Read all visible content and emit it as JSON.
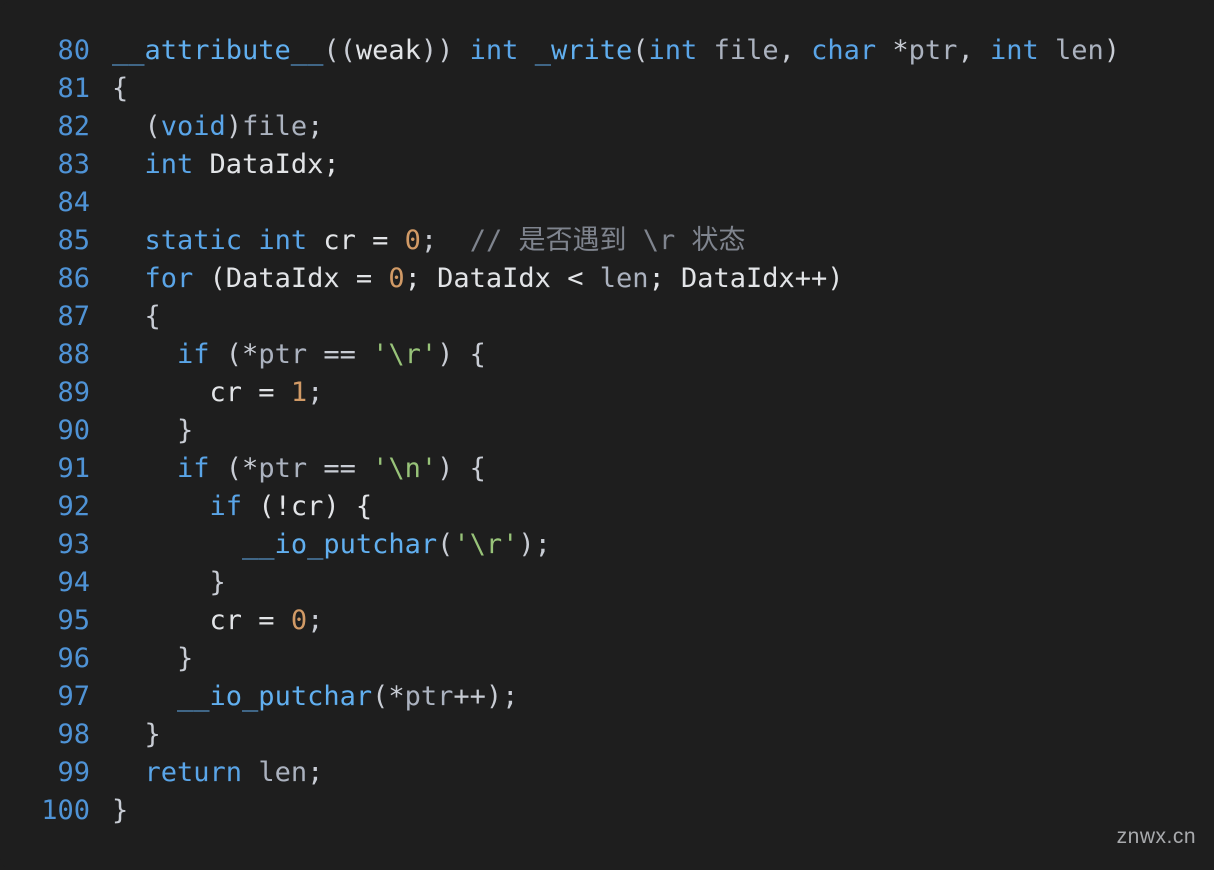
{
  "watermark": "znwx.cn",
  "lines": [
    {
      "num": "80",
      "tokens": [
        {
          "t": "__attribute__",
          "c": "call"
        },
        {
          "t": "((",
          "c": "punct"
        },
        {
          "t": "weak",
          "c": "id"
        },
        {
          "t": ")) ",
          "c": "punct"
        },
        {
          "t": "int",
          "c": "kw"
        },
        {
          "t": " ",
          "c": "punct"
        },
        {
          "t": "_write",
          "c": "call"
        },
        {
          "t": "(",
          "c": "punct"
        },
        {
          "t": "int",
          "c": "kw"
        },
        {
          "t": " ",
          "c": "punct"
        },
        {
          "t": "file",
          "c": "par"
        },
        {
          "t": ", ",
          "c": "punct"
        },
        {
          "t": "char",
          "c": "kw"
        },
        {
          "t": " *",
          "c": "punct"
        },
        {
          "t": "ptr",
          "c": "par"
        },
        {
          "t": ", ",
          "c": "punct"
        },
        {
          "t": "int",
          "c": "kw"
        },
        {
          "t": " ",
          "c": "punct"
        },
        {
          "t": "len",
          "c": "par"
        },
        {
          "t": ")",
          "c": "punct"
        }
      ]
    },
    {
      "num": "81",
      "tokens": [
        {
          "t": "{",
          "c": "punct"
        }
      ]
    },
    {
      "num": "82",
      "tokens": [
        {
          "t": "  (",
          "c": "punct"
        },
        {
          "t": "void",
          "c": "kw"
        },
        {
          "t": ")",
          "c": "punct"
        },
        {
          "t": "file",
          "c": "par"
        },
        {
          "t": ";",
          "c": "punct"
        }
      ]
    },
    {
      "num": "83",
      "tokens": [
        {
          "t": "  ",
          "c": "punct"
        },
        {
          "t": "int",
          "c": "kw"
        },
        {
          "t": " DataIdx;",
          "c": "id"
        }
      ]
    },
    {
      "num": "84",
      "tokens": [
        {
          "t": "",
          "c": "punct"
        }
      ]
    },
    {
      "num": "85",
      "tokens": [
        {
          "t": "  ",
          "c": "punct"
        },
        {
          "t": "static",
          "c": "kw2"
        },
        {
          "t": " ",
          "c": "punct"
        },
        {
          "t": "int",
          "c": "kw"
        },
        {
          "t": " cr = ",
          "c": "id"
        },
        {
          "t": "0",
          "c": "num"
        },
        {
          "t": ";  ",
          "c": "punct"
        },
        {
          "t": "// 是否遇到 \\r 状态",
          "c": "cmt"
        }
      ]
    },
    {
      "num": "86",
      "tokens": [
        {
          "t": "  ",
          "c": "punct"
        },
        {
          "t": "for",
          "c": "kw"
        },
        {
          "t": " (DataIdx = ",
          "c": "id"
        },
        {
          "t": "0",
          "c": "num"
        },
        {
          "t": "; DataIdx < ",
          "c": "id"
        },
        {
          "t": "len",
          "c": "par"
        },
        {
          "t": "; DataIdx++)",
          "c": "id"
        }
      ]
    },
    {
      "num": "87",
      "tokens": [
        {
          "t": "  {",
          "c": "punct"
        }
      ]
    },
    {
      "num": "88",
      "tokens": [
        {
          "t": "    ",
          "c": "punct"
        },
        {
          "t": "if",
          "c": "kw"
        },
        {
          "t": " (*",
          "c": "punct"
        },
        {
          "t": "ptr",
          "c": "par"
        },
        {
          "t": " == ",
          "c": "punct"
        },
        {
          "t": "'\\r'",
          "c": "str"
        },
        {
          "t": ") {",
          "c": "punct"
        }
      ]
    },
    {
      "num": "89",
      "tokens": [
        {
          "t": "      cr = ",
          "c": "id"
        },
        {
          "t": "1",
          "c": "num"
        },
        {
          "t": ";",
          "c": "punct"
        }
      ]
    },
    {
      "num": "90",
      "tokens": [
        {
          "t": "    }",
          "c": "punct"
        }
      ]
    },
    {
      "num": "91",
      "tokens": [
        {
          "t": "    ",
          "c": "punct"
        },
        {
          "t": "if",
          "c": "kw"
        },
        {
          "t": " (*",
          "c": "punct"
        },
        {
          "t": "ptr",
          "c": "par"
        },
        {
          "t": " == ",
          "c": "punct"
        },
        {
          "t": "'\\n'",
          "c": "str"
        },
        {
          "t": ") {",
          "c": "punct"
        }
      ]
    },
    {
      "num": "92",
      "tokens": [
        {
          "t": "      ",
          "c": "punct"
        },
        {
          "t": "if",
          "c": "kw"
        },
        {
          "t": " (!cr) {",
          "c": "id"
        }
      ]
    },
    {
      "num": "93",
      "tokens": [
        {
          "t": "        ",
          "c": "punct"
        },
        {
          "t": "__io_putchar",
          "c": "call"
        },
        {
          "t": "(",
          "c": "punct"
        },
        {
          "t": "'\\r'",
          "c": "str"
        },
        {
          "t": ");",
          "c": "punct"
        }
      ]
    },
    {
      "num": "94",
      "tokens": [
        {
          "t": "      }",
          "c": "punct"
        }
      ]
    },
    {
      "num": "95",
      "tokens": [
        {
          "t": "      cr = ",
          "c": "id"
        },
        {
          "t": "0",
          "c": "num"
        },
        {
          "t": ";",
          "c": "punct"
        }
      ]
    },
    {
      "num": "96",
      "tokens": [
        {
          "t": "    }",
          "c": "punct"
        }
      ]
    },
    {
      "num": "97",
      "tokens": [
        {
          "t": "    ",
          "c": "punct"
        },
        {
          "t": "__io_putchar",
          "c": "call"
        },
        {
          "t": "(*",
          "c": "punct"
        },
        {
          "t": "ptr",
          "c": "par"
        },
        {
          "t": "++);",
          "c": "punct"
        }
      ]
    },
    {
      "num": "98",
      "tokens": [
        {
          "t": "  }",
          "c": "punct"
        }
      ]
    },
    {
      "num": "99",
      "tokens": [
        {
          "t": "  ",
          "c": "punct"
        },
        {
          "t": "return",
          "c": "kw"
        },
        {
          "t": " ",
          "c": "punct"
        },
        {
          "t": "len",
          "c": "par"
        },
        {
          "t": ";",
          "c": "punct"
        }
      ]
    },
    {
      "num": "100",
      "tokens": [
        {
          "t": "}",
          "c": "punct"
        }
      ]
    }
  ]
}
